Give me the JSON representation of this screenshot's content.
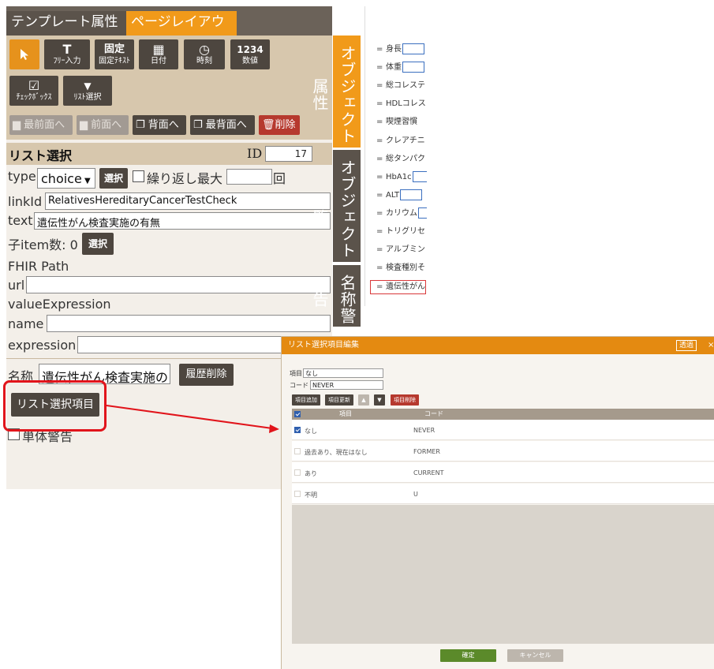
{
  "tabs": {
    "template_attr": "テンプレート属性",
    "page_layout": "ページレイアウト"
  },
  "tools": {
    "select_icon": "cursor-icon",
    "free_text_glyph": "T",
    "free_text": "ﾌﾘｰ入力",
    "fixed_glyph": "固定",
    "fixed_text": "固定ﾃｷｽﾄ",
    "date_glyph": "▦",
    "date": "日付",
    "time_glyph": "◷",
    "time": "時刻",
    "number_glyph": "1234",
    "number": "数値",
    "checkbox_glyph": "☑",
    "checkbox": "ﾁｪｯｸﾎﾞｯｸｽ",
    "list_glyph": "▼",
    "list_select": "ﾘｽﾄ選択"
  },
  "actions": {
    "bring_front": "最前面へ",
    "forward": "前面へ",
    "backward": "背面へ",
    "send_back": "最背面へ",
    "delete": "削除"
  },
  "props": {
    "title": "リスト選択",
    "id_label": "ID",
    "id_value": "17",
    "type_label": "type",
    "type_value": "choice",
    "select_label": "選択",
    "repeat_label": "繰り返し最大",
    "repeat_unit": "回",
    "linkid_label": "linkId",
    "linkid_value": "RelativesHereditaryCancerTestCheck",
    "text_label": "text",
    "text_value": "遺伝性がん検査実施の有無",
    "child_count_label": "子item数: 0",
    "child_select": "選択",
    "fhir_path": "FHIR Path",
    "url_label": "url",
    "value_expression": "valueExpression",
    "name_label": "name",
    "expression_label": "expression",
    "meisho_label": "名称",
    "meisho_value": "遺伝性がん検査実施の",
    "history_delete": "履歴削除",
    "list_items_button": "リスト選択項目",
    "single_warning": "単体警告"
  },
  "side_tabs": {
    "object_attr": "オブジェクト属性",
    "object_list": "オブジェクト一覧",
    "name_warning": "名称警告"
  },
  "right_list": [
    {
      "label": "身長",
      "box": true
    },
    {
      "label": "体重",
      "box": true
    },
    {
      "label": "総コレステ",
      "box": false
    },
    {
      "label": "HDLコレス",
      "box": false
    },
    {
      "label": "喫煙習慣",
      "box": false
    },
    {
      "label": "クレアチニ",
      "box": false
    },
    {
      "label": "総タンパク",
      "box": false
    },
    {
      "label": "HbA1c",
      "box": true
    },
    {
      "label": "ALT",
      "box": true
    },
    {
      "label": "カリウム",
      "box": true
    },
    {
      "label": "トリグリセ",
      "box": false
    },
    {
      "label": "アルブミン",
      "box": false
    },
    {
      "label": "検査種別そ",
      "box": false
    },
    {
      "label": "遺伝性がん",
      "box": false,
      "highlight": true
    }
  ],
  "right_list_eq": "=",
  "dialog": {
    "title": "リスト選択項目編集",
    "transparent": "透過",
    "close": "×",
    "item_label": "項目",
    "item_value": "なし",
    "code_label": "コード",
    "code_value": "NEVER",
    "add_item": "項目追加",
    "update_item": "項目更新",
    "up_glyph": "▲",
    "down_glyph": "▼",
    "delete_item": "項目削除",
    "col_item": "項目",
    "col_code": "コード",
    "rows": [
      {
        "item": "なし",
        "code": "NEVER",
        "checked": true
      },
      {
        "item": "過去あり、現在はなし",
        "code": "FORMER",
        "checked": false
      },
      {
        "item": "あり",
        "code": "CURRENT",
        "checked": false
      },
      {
        "item": "不明",
        "code": "U",
        "checked": false
      }
    ],
    "ok": "確定",
    "cancel": "キャンセル"
  },
  "colors": {
    "accent": "#f19a1a",
    "dialog_header": "#e48a11",
    "annotation": "#e1141b",
    "dark_button": "#4d463f"
  }
}
